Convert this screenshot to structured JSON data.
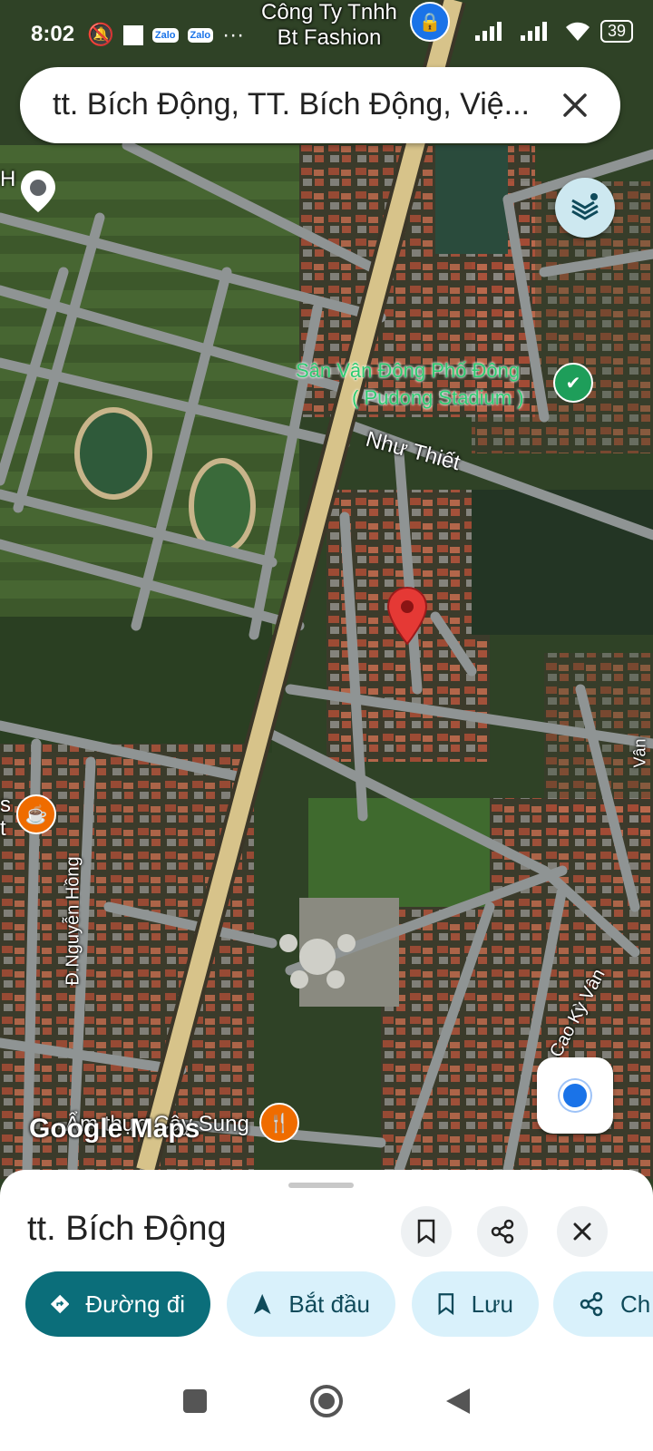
{
  "status_bar": {
    "time": "8:02",
    "zalo_label": "Zalo",
    "more": "···",
    "battery": "39"
  },
  "search": {
    "query": "tt. Bích Động, TT. Bích Động, Việ..."
  },
  "map": {
    "labels": {
      "company": "Công Ty Tnhh\nBt Fashion",
      "stadium": "Sân Vận Động Phố Đông",
      "stadium_en": "( Pudong Stadium )",
      "road_nhu_thiet": "Như Thiết",
      "road_nguyen_hong": "Đ.Nguyễn Hồng",
      "road_cao_ky_van": "Cao Kỳ Vân",
      "restaurant": "Ẩm thực Cây Sung",
      "edge_s": "s",
      "edge_t": "t",
      "edge_h": "H",
      "edge_van": "Vân"
    },
    "watermark": "Google Maps",
    "pin_color": "#e53935"
  },
  "sheet": {
    "title": "tt. Bích Động",
    "chips": {
      "directions": "Đường đi",
      "start": "Bắt đầu",
      "save": "Lưu",
      "share": "Ch"
    }
  },
  "colors": {
    "primary": "#0b6e7a",
    "chip_light": "#d9f1fb",
    "location_blue": "#1a73e8"
  }
}
